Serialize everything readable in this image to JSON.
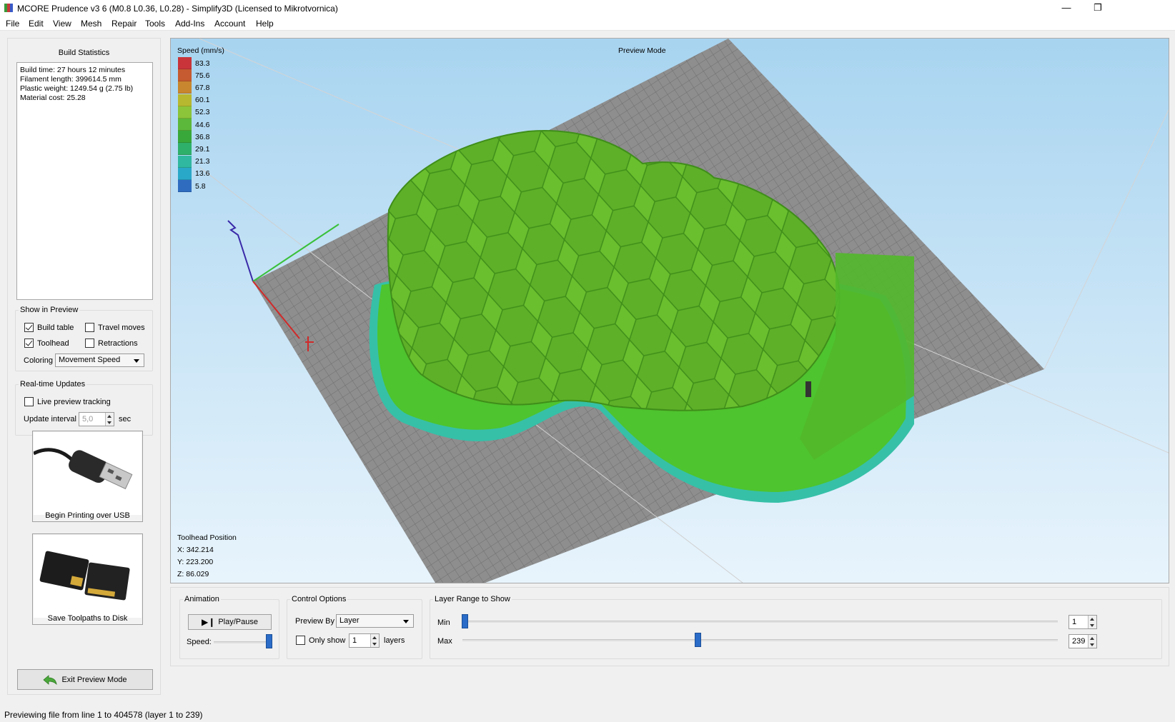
{
  "window": {
    "title": "MCORE Prudence v3 6 (M0.8 L0.36, L0.28) - Simplify3D (Licensed to Mikrotvornica)",
    "minimize_glyph": "—",
    "restore_glyph": "❐"
  },
  "menu": [
    "File",
    "Edit",
    "View",
    "Mesh",
    "Repair",
    "Tools",
    "Add-Ins",
    "Account",
    "Help"
  ],
  "build_statistics": {
    "title": "Build Statistics",
    "lines": [
      "Build time: 27 hours 12 minutes",
      "Filament length: 399614.5 mm",
      "Plastic weight: 1249.54 g (2.75 lb)",
      "Material cost: 25.28"
    ]
  },
  "show_in_preview": {
    "title": "Show in Preview",
    "build_table": {
      "label": "Build table",
      "checked": true
    },
    "travel_moves": {
      "label": "Travel moves",
      "checked": false
    },
    "toolhead": {
      "label": "Toolhead",
      "checked": true
    },
    "retractions": {
      "label": "Retractions",
      "checked": false
    },
    "coloring_label": "Coloring",
    "coloring_value": "Movement Speed"
  },
  "realtime": {
    "title": "Real-time Updates",
    "live_preview": {
      "label": "Live preview tracking",
      "checked": false
    },
    "interval_label": "Update interval",
    "interval_value": "5,0",
    "interval_unit": "sec"
  },
  "actions": {
    "usb_label": "Begin Printing over USB",
    "disk_label": "Save Toolpaths to Disk",
    "exit_label": "Exit Preview Mode"
  },
  "viewport": {
    "mode_label": "Preview Mode",
    "legend_title": "Speed (mm/s)",
    "legend": [
      {
        "value": "83.3",
        "color": "#c8343a"
      },
      {
        "value": "75.6",
        "color": "#c65a30"
      },
      {
        "value": "67.8",
        "color": "#c8862e"
      },
      {
        "value": "60.1",
        "color": "#b8b830"
      },
      {
        "value": "52.3",
        "color": "#8cc43a"
      },
      {
        "value": "44.6",
        "color": "#5cb83a"
      },
      {
        "value": "36.8",
        "color": "#38a83a"
      },
      {
        "value": "29.1",
        "color": "#2eb06a"
      },
      {
        "value": "21.3",
        "color": "#30b8a0"
      },
      {
        "value": "13.6",
        "color": "#2aa8c8"
      },
      {
        "value": "5.8",
        "color": "#2f6cc0"
      }
    ],
    "toolhead_title": "Toolhead Position",
    "x": "X: 342.214",
    "y": "Y: 223.200",
    "z": "Z: 86.029"
  },
  "animation": {
    "title": "Animation",
    "play_label": "Play/Pause",
    "speed_label": "Speed:",
    "speed_level": 1.0
  },
  "control_options": {
    "title": "Control Options",
    "preview_by_label": "Preview By",
    "preview_by_value": "Layer",
    "only_show_label": "Only show",
    "only_show_checked": false,
    "only_show_value": "1",
    "layers_label": "layers"
  },
  "layer_range": {
    "title": "Layer Range to Show",
    "min_label": "Min",
    "min_value": "1",
    "max_label": "Max",
    "max_value": "239",
    "total_layers": 239
  },
  "status": "Previewing file from line 1 to 404578 (layer 1 to 239)"
}
